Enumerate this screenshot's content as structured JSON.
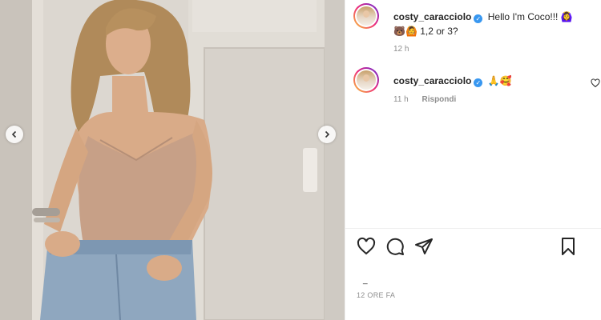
{
  "post": {
    "image_alt": "Photo of a woman in a nude bodysuit and jeans leaning against a door"
  },
  "caption": {
    "username": "costy_caracciolo",
    "text": "Hello I'm Coco!!! 🙆‍♀️ 🐻🙆 1,2 or 3?",
    "time": "12 h"
  },
  "comment": {
    "username": "costy_caracciolo",
    "text": "🙏🥰",
    "time": "11 h",
    "reply_label": "Rispondi"
  },
  "likes": {
    "text": "_"
  },
  "timestamp": "12 ORE FA",
  "colors": {
    "verified": "#3897f0",
    "text": "#262626",
    "muted": "#8e8e8e"
  }
}
